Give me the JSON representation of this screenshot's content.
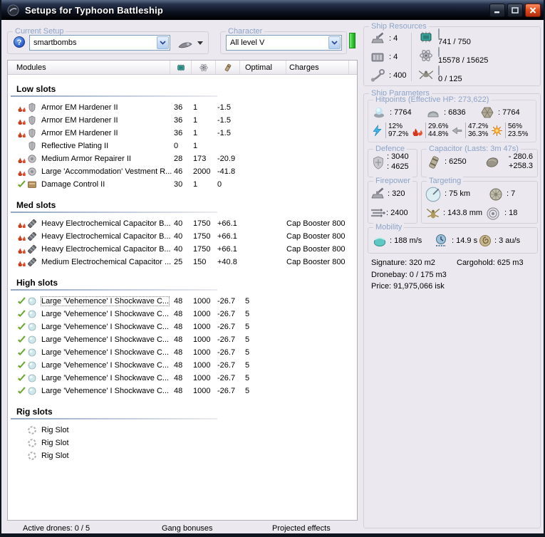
{
  "window": {
    "title": "Setups for Typhoon Battleship"
  },
  "colors": {
    "titlebar": "#0d1220",
    "group_label": "#8da3c8",
    "progress_green": "#55e055",
    "flames_red": "#c63b1c",
    "check_green": "#69a82f",
    "close_red": "#e04f1f",
    "character_bar_green": "#2fc22f"
  },
  "toolbar": {
    "current_setup": {
      "label": "Current Setup",
      "value": "smartbombs"
    },
    "character": {
      "label": "Character",
      "value": "All level V"
    }
  },
  "modules_table": {
    "header": {
      "modules": "Modules",
      "optimal": "Optimal",
      "charges": "Charges"
    },
    "sections": [
      {
        "title": "Low slots",
        "rows": [
          {
            "state": "flames",
            "icon": "armor-hardener",
            "name": "Armor EM Hardener II",
            "cpu": "36",
            "pg": "1",
            "cap": "-1.5",
            "optimal": "",
            "charge": ""
          },
          {
            "state": "flames",
            "icon": "armor-hardener",
            "name": "Armor EM Hardener II",
            "cpu": "36",
            "pg": "1",
            "cap": "-1.5",
            "optimal": "",
            "charge": ""
          },
          {
            "state": "flames",
            "icon": "armor-hardener",
            "name": "Armor EM Hardener II",
            "cpu": "36",
            "pg": "1",
            "cap": "-1.5",
            "optimal": "",
            "charge": ""
          },
          {
            "state": "",
            "icon": "armor-hardener",
            "name": "Reflective Plating II",
            "cpu": "0",
            "pg": "1",
            "cap": "",
            "optimal": "",
            "charge": ""
          },
          {
            "state": "flames",
            "icon": "armor-repairer",
            "name": "Medium Armor Repairer II",
            "cpu": "28",
            "pg": "173",
            "cap": "-20.9",
            "optimal": "",
            "charge": ""
          },
          {
            "state": "flames",
            "icon": "armor-repairer",
            "name": "Large 'Accommodation' Vestment R...",
            "cpu": "46",
            "pg": "2000",
            "cap": "-41.8",
            "optimal": "",
            "charge": ""
          },
          {
            "state": "check",
            "icon": "damage-control",
            "name": "Damage Control II",
            "cpu": "30",
            "pg": "1",
            "cap": "0",
            "optimal": "",
            "charge": ""
          }
        ]
      },
      {
        "title": "Med slots",
        "rows": [
          {
            "state": "flames",
            "icon": "cap-booster",
            "name": "Heavy Electrochemical Capacitor B...",
            "cpu": "40",
            "pg": "1750",
            "cap": "+66.1",
            "optimal": "",
            "charge": "Cap Booster 800"
          },
          {
            "state": "flames",
            "icon": "cap-booster",
            "name": "Heavy Electrochemical Capacitor B...",
            "cpu": "40",
            "pg": "1750",
            "cap": "+66.1",
            "optimal": "",
            "charge": "Cap Booster 800"
          },
          {
            "state": "flames",
            "icon": "cap-booster",
            "name": "Heavy Electrochemical Capacitor B...",
            "cpu": "40",
            "pg": "1750",
            "cap": "+66.1",
            "optimal": "",
            "charge": "Cap Booster 800"
          },
          {
            "state": "flames",
            "icon": "cap-booster",
            "name": "Medium Electrochemical Capacitor ...",
            "cpu": "25",
            "pg": "150",
            "cap": "+40.8",
            "optimal": "",
            "charge": "Cap Booster 800"
          }
        ]
      },
      {
        "title": "High slots",
        "rows": [
          {
            "state": "check",
            "icon": "smartbomb",
            "name": "Large 'Vehemence' I Shockwave C...",
            "cpu": "48",
            "pg": "1000",
            "cap": "-26.7",
            "optimal": "5",
            "charge": "",
            "focused": true
          },
          {
            "state": "check",
            "icon": "smartbomb",
            "name": "Large 'Vehemence' I Shockwave C...",
            "cpu": "48",
            "pg": "1000",
            "cap": "-26.7",
            "optimal": "5",
            "charge": ""
          },
          {
            "state": "check",
            "icon": "smartbomb",
            "name": "Large 'Vehemence' I Shockwave C...",
            "cpu": "48",
            "pg": "1000",
            "cap": "-26.7",
            "optimal": "5",
            "charge": ""
          },
          {
            "state": "check",
            "icon": "smartbomb",
            "name": "Large 'Vehemence' I Shockwave C...",
            "cpu": "48",
            "pg": "1000",
            "cap": "-26.7",
            "optimal": "5",
            "charge": ""
          },
          {
            "state": "check",
            "icon": "smartbomb",
            "name": "Large 'Vehemence' I Shockwave C...",
            "cpu": "48",
            "pg": "1000",
            "cap": "-26.7",
            "optimal": "5",
            "charge": ""
          },
          {
            "state": "check",
            "icon": "smartbomb",
            "name": "Large 'Vehemence' I Shockwave C...",
            "cpu": "48",
            "pg": "1000",
            "cap": "-26.7",
            "optimal": "5",
            "charge": ""
          },
          {
            "state": "check",
            "icon": "smartbomb",
            "name": "Large 'Vehemence' I Shockwave C...",
            "cpu": "48",
            "pg": "1000",
            "cap": "-26.7",
            "optimal": "5",
            "charge": ""
          },
          {
            "state": "check",
            "icon": "smartbomb",
            "name": "Large 'Vehemence' I Shockwave C...",
            "cpu": "48",
            "pg": "1000",
            "cap": "-26.7",
            "optimal": "5",
            "charge": ""
          }
        ]
      },
      {
        "title": "Rig slots",
        "rows": [
          {
            "state": "",
            "icon": "rig-slot",
            "name": "Rig Slot",
            "cpu": "",
            "pg": "",
            "cap": "",
            "optimal": "",
            "charge": ""
          },
          {
            "state": "",
            "icon": "rig-slot",
            "name": "Rig Slot",
            "cpu": "",
            "pg": "",
            "cap": "",
            "optimal": "",
            "charge": ""
          },
          {
            "state": "",
            "icon": "rig-slot",
            "name": "Rig Slot",
            "cpu": "",
            "pg": "",
            "cap": "",
            "optimal": "",
            "charge": ""
          }
        ]
      }
    ]
  },
  "ship_resources": {
    "label": "Ship Resources",
    "hardpoints": [
      {
        "icon": "turret",
        "value": ": 4"
      },
      {
        "icon": "launcher",
        "value": ": 4"
      },
      {
        "icon": "calibration",
        "value": ": 400"
      }
    ],
    "bars": [
      {
        "icon": "cpu",
        "text": "741 / 750",
        "pct": 98.8
      },
      {
        "icon": "powergrid",
        "text": "15578 / 15625",
        "pct": 99.7
      },
      {
        "icon": "drone",
        "text": "0 / 125",
        "pct": 0
      }
    ]
  },
  "ship_parameters": {
    "label": "Ship Parameters",
    "hitpoints": {
      "label": "Hitpoints (Effective HP: 273,622)",
      "pools": [
        {
          "icon": "shield",
          "value": ": 7764"
        },
        {
          "icon": "armor",
          "value": ": 6836"
        },
        {
          "icon": "structure",
          "value": ": 7764"
        }
      ],
      "resists": [
        {
          "icon": "em",
          "shield": "12%",
          "armor": "97.2%"
        },
        {
          "icon": "thermal",
          "shield": "29.6%",
          "armor": "44.8%"
        },
        {
          "icon": "kinetic",
          "shield": "47.2%",
          "armor": "36.3%"
        },
        {
          "icon": "explosive",
          "shield": "56%",
          "armor": "23.5%"
        }
      ]
    },
    "defence": {
      "label": "Defence",
      "value1": ": 3040",
      "value2": ": 4625"
    },
    "capacitor": {
      "label": "Capacitor (Lasts: 3m 47s)",
      "amount": ": 6250",
      "drain": "- 280.6",
      "recharge": "+258.3"
    },
    "firepower": {
      "label": "Firepower",
      "turret_dps": ": 320",
      "volley": ": 2400"
    },
    "targeting": {
      "label": "Targeting",
      "range": ": 75 km",
      "max_targets": ": 7",
      "scan_res": ": 143.8 mm",
      "locked": ": 18"
    },
    "mobility": {
      "label": "Mobility",
      "speed": ": 188 m/s",
      "align": ": 14.9 s",
      "warp": ": 3 au/s"
    },
    "stats": {
      "signature": "Signature: 320 m2",
      "cargohold": "Cargohold: 625 m3",
      "dronebay": "Dronebay: 0 / 175 m3",
      "price": "Price: 91,975,066 isk"
    }
  },
  "status_bar": {
    "active_drones": "Active drones: 0 / 5",
    "gang_bonuses": "Gang bonuses",
    "projected_effects": "Projected effects"
  }
}
